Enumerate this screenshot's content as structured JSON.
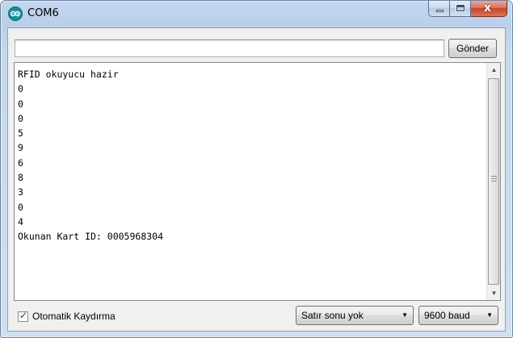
{
  "window": {
    "title": "COM6",
    "close_symbol": "x"
  },
  "toolbar": {
    "input_value": "",
    "send_label": "Gönder"
  },
  "serial_output": {
    "lines": [
      "RFID okuyucu hazir",
      "0",
      "0",
      "0",
      "5",
      "9",
      "6",
      "8",
      "3",
      "0",
      "4",
      "Okunan Kart ID: 0005968304"
    ]
  },
  "footer": {
    "autoscroll_label": "Otomatik Kaydırma",
    "autoscroll_checked": true,
    "line_ending_value": "Satır sonu yok",
    "baud_value": "9600 baud"
  },
  "icons": {
    "app": "arduino-icon",
    "minimize": "minimize-icon",
    "maximize": "maximize-icon",
    "close": "close-icon",
    "scroll_up": "arrow-up-icon",
    "scroll_down": "arrow-down-icon",
    "dropdown": "chevron-down-icon",
    "check": "checkmark-icon"
  },
  "colors": {
    "frame": "#c4d7ee",
    "close_button": "#c4432a",
    "arduino_teal": "#1b8c97"
  }
}
